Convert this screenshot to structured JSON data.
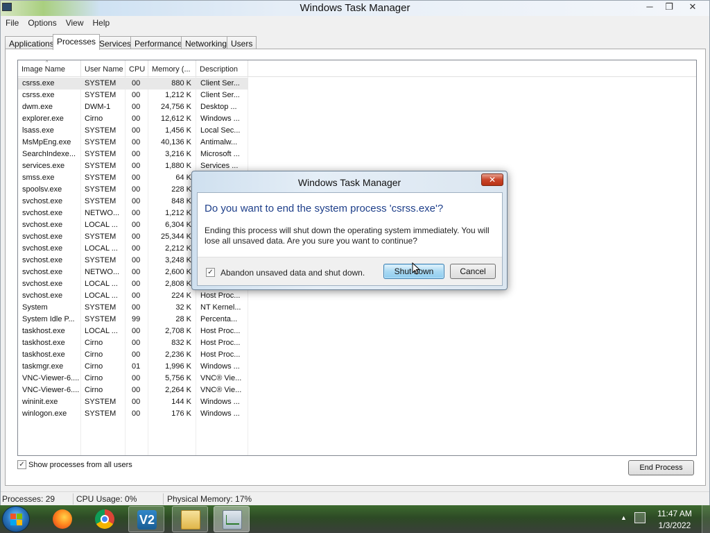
{
  "window": {
    "title": "Windows Task Manager",
    "min_glyph": "─",
    "max_glyph": "❐",
    "close_glyph": "✕"
  },
  "menu": [
    "File",
    "Options",
    "View",
    "Help"
  ],
  "tabs": [
    "Applications",
    "Processes",
    "Services",
    "Performance",
    "Networking",
    "Users"
  ],
  "active_tab": "Processes",
  "columns": [
    "Image Name",
    "User Name",
    "CPU",
    "Memory (...",
    "Description"
  ],
  "sort_indicator": "^",
  "processes": [
    {
      "name": "csrss.exe",
      "user": "SYSTEM",
      "cpu": "00",
      "mem": "880 K",
      "desc": "Client Ser..."
    },
    {
      "name": "csrss.exe",
      "user": "SYSTEM",
      "cpu": "00",
      "mem": "1,212 K",
      "desc": "Client Ser..."
    },
    {
      "name": "dwm.exe",
      "user": "DWM-1",
      "cpu": "00",
      "mem": "24,756 K",
      "desc": "Desktop ..."
    },
    {
      "name": "explorer.exe",
      "user": "Cirno",
      "cpu": "00",
      "mem": "12,612 K",
      "desc": "Windows ..."
    },
    {
      "name": "lsass.exe",
      "user": "SYSTEM",
      "cpu": "00",
      "mem": "1,456 K",
      "desc": "Local Sec..."
    },
    {
      "name": "MsMpEng.exe",
      "user": "SYSTEM",
      "cpu": "00",
      "mem": "40,136 K",
      "desc": "Antimalw..."
    },
    {
      "name": "SearchIndexe...",
      "user": "SYSTEM",
      "cpu": "00",
      "mem": "3,216 K",
      "desc": "Microsoft ..."
    },
    {
      "name": "services.exe",
      "user": "SYSTEM",
      "cpu": "00",
      "mem": "1,880 K",
      "desc": "Services ..."
    },
    {
      "name": "smss.exe",
      "user": "SYSTEM",
      "cpu": "00",
      "mem": "64 K",
      "desc": ""
    },
    {
      "name": "spoolsv.exe",
      "user": "SYSTEM",
      "cpu": "00",
      "mem": "228 K",
      "desc": ""
    },
    {
      "name": "svchost.exe",
      "user": "SYSTEM",
      "cpu": "00",
      "mem": "848 K",
      "desc": ""
    },
    {
      "name": "svchost.exe",
      "user": "NETWO...",
      "cpu": "00",
      "mem": "1,212 K",
      "desc": ""
    },
    {
      "name": "svchost.exe",
      "user": "LOCAL ...",
      "cpu": "00",
      "mem": "6,304 K",
      "desc": ""
    },
    {
      "name": "svchost.exe",
      "user": "SYSTEM",
      "cpu": "00",
      "mem": "25,344 K",
      "desc": ""
    },
    {
      "name": "svchost.exe",
      "user": "LOCAL ...",
      "cpu": "00",
      "mem": "2,212 K",
      "desc": ""
    },
    {
      "name": "svchost.exe",
      "user": "SYSTEM",
      "cpu": "00",
      "mem": "3,248 K",
      "desc": ""
    },
    {
      "name": "svchost.exe",
      "user": "NETWO...",
      "cpu": "00",
      "mem": "2,600 K",
      "desc": ""
    },
    {
      "name": "svchost.exe",
      "user": "LOCAL ...",
      "cpu": "00",
      "mem": "2,808 K",
      "desc": ""
    },
    {
      "name": "svchost.exe",
      "user": "LOCAL ...",
      "cpu": "00",
      "mem": "224 K",
      "desc": "Host Proc..."
    },
    {
      "name": "System",
      "user": "SYSTEM",
      "cpu": "00",
      "mem": "32 K",
      "desc": "NT Kernel..."
    },
    {
      "name": "System Idle P...",
      "user": "SYSTEM",
      "cpu": "99",
      "mem": "28 K",
      "desc": "Percenta..."
    },
    {
      "name": "taskhost.exe",
      "user": "LOCAL ...",
      "cpu": "00",
      "mem": "2,708 K",
      "desc": "Host Proc..."
    },
    {
      "name": "taskhost.exe",
      "user": "Cirno",
      "cpu": "00",
      "mem": "832 K",
      "desc": "Host Proc..."
    },
    {
      "name": "taskhost.exe",
      "user": "Cirno",
      "cpu": "00",
      "mem": "2,236 K",
      "desc": "Host Proc..."
    },
    {
      "name": "taskmgr.exe",
      "user": "Cirno",
      "cpu": "01",
      "mem": "1,996 K",
      "desc": "Windows ..."
    },
    {
      "name": "VNC-Viewer-6....",
      "user": "Cirno",
      "cpu": "00",
      "mem": "5,756 K",
      "desc": "VNC® Vie..."
    },
    {
      "name": "VNC-Viewer-6....",
      "user": "Cirno",
      "cpu": "00",
      "mem": "2,264 K",
      "desc": "VNC® Vie..."
    },
    {
      "name": "wininit.exe",
      "user": "SYSTEM",
      "cpu": "00",
      "mem": "144 K",
      "desc": "Windows ..."
    },
    {
      "name": "winlogon.exe",
      "user": "SYSTEM",
      "cpu": "00",
      "mem": "176 K",
      "desc": "Windows ..."
    }
  ],
  "show_all_users": {
    "label": "Show processes from all users",
    "checked": true,
    "check_glyph": "✓"
  },
  "end_process_label": "End Process",
  "status": {
    "processes": "Processes: 29",
    "cpu": "CPU Usage: 0%",
    "memory": "Physical Memory: 17%"
  },
  "dialog": {
    "title": "Windows Task Manager",
    "close_glyph": "✕",
    "heading": "Do you want to end the system process 'csrss.exe'?",
    "message": "Ending this process will shut down the operating system immediately.  You will lose all unsaved data.  Are you sure you want to continue?",
    "abandon_label": "Abandon unsaved data and shut down.",
    "abandon_checked": true,
    "check_glyph": "✓",
    "shutdown_label": "Shut down",
    "cancel_label": "Cancel"
  },
  "taskbar": {
    "vnc_glyph": "V2",
    "tray_arrow": "▲",
    "time": "11:47 AM",
    "date": "1/3/2022"
  },
  "icons": {
    "start": "windows-start-orb",
    "firefox": "firefox-icon",
    "chrome": "chrome-icon",
    "vnc": "vnc-viewer-icon",
    "explorer": "folder-icon",
    "taskmgr": "task-manager-icon"
  }
}
